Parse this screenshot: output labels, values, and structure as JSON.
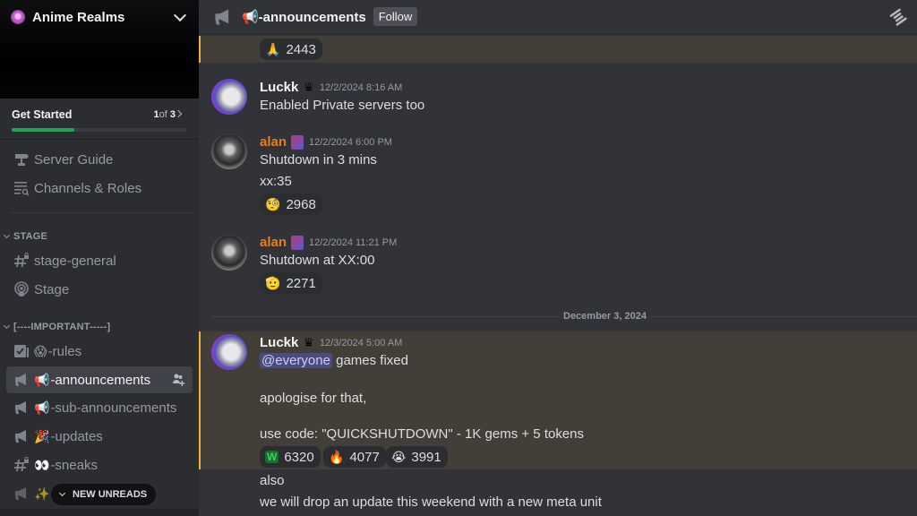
{
  "server": {
    "name": "Anime Realms",
    "icon": "server-globe-icon"
  },
  "get_started": {
    "title": "Get Started",
    "current": "1",
    "of": "of",
    "total": "3",
    "progress": 0.36,
    "progress_color": "#23a559"
  },
  "sidebar": {
    "top_items": [
      {
        "label": "Server Guide",
        "icon": "signpost-icon"
      },
      {
        "label": "Channels & Roles",
        "icon": "channels-browse-icon"
      }
    ],
    "categories": [
      {
        "name": "STAGE",
        "channels": [
          {
            "label": "stage-general",
            "icon": "locked-text-channel-icon",
            "emoji": ""
          },
          {
            "label": "Stage",
            "icon": "stage-icon",
            "emoji": ""
          }
        ]
      },
      {
        "name": "[----IMPORTANT-----]",
        "channels": [
          {
            "label": "-rules",
            "icon": "rules-icon",
            "emoji": "😱"
          },
          {
            "label": "-announcements",
            "icon": "announcement-icon",
            "emoji": "📢",
            "active": true
          },
          {
            "label": "-sub-announcements",
            "icon": "announcement-icon",
            "emoji": "📢"
          },
          {
            "label": "-updates",
            "icon": "announcement-icon",
            "emoji": "🎉"
          },
          {
            "label": "-sneaks",
            "icon": "locked-text-channel-icon",
            "emoji": "👀"
          },
          {
            "label": "",
            "icon": "announcement-icon",
            "emoji": "✨"
          }
        ]
      }
    ],
    "new_unreads_label": "NEW UNREADS"
  },
  "channel": {
    "name": "📢-announcements",
    "follow_label": "Follow",
    "accent": "#f0b232"
  },
  "messages": [
    {
      "reactions": [
        {
          "emoji": "🙏",
          "count": "2443"
        }
      ]
    },
    {
      "author": "Luckk",
      "author_color": "#f2f3f5",
      "badge": "crown",
      "timestamp": "12/2/2024 8:16 AM",
      "lines": [
        "Enabled Private servers too"
      ]
    },
    {
      "author": "alan",
      "author_color": "#e67e22",
      "badge": "scroll",
      "timestamp": "12/2/2024 6:00 PM",
      "lines": [
        "Shutdown in 3 mins",
        "xx:35"
      ],
      "reactions": [
        {
          "emoji": "🧐",
          "count": "2968"
        }
      ]
    },
    {
      "author": "alan",
      "author_color": "#e67e22",
      "badge": "scroll",
      "timestamp": "12/2/2024 11:21 PM",
      "lines": [
        "Shutdown at XX:00"
      ],
      "reactions": [
        {
          "emoji": "🫡",
          "count": "2271"
        }
      ]
    },
    {
      "date_separator": "December 3, 2024"
    },
    {
      "author": "Luckk",
      "author_color": "#f2f3f5",
      "badge": "crown",
      "timestamp": "12/3/2024 5:00 AM",
      "mention": "@everyone",
      "lines": [
        "games fixed",
        "apologise for that,",
        "use code: \"QUICKSHUTDOWN\"  - 1K gems + 5 tokens"
      ],
      "reactions": [
        {
          "emoji": "W",
          "count": "6320"
        },
        {
          "emoji": "🔥",
          "count": "4077"
        },
        {
          "emoji": "😭",
          "count": "3991"
        }
      ]
    },
    {
      "lines": [
        "also",
        "we will drop an update this weekend with a new meta unit"
      ]
    }
  ]
}
